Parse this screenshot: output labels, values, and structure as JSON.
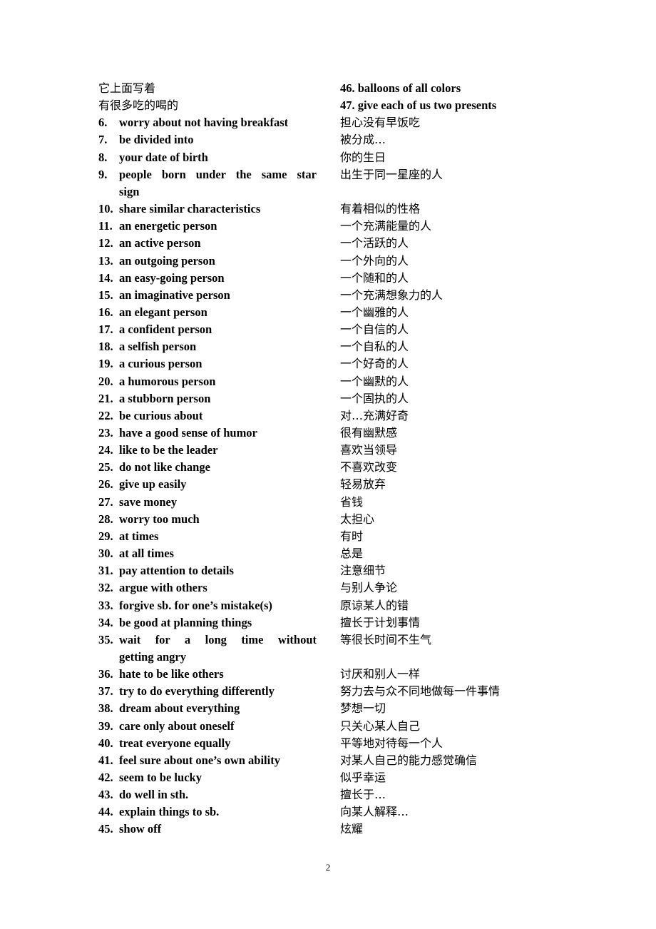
{
  "top_rows": [
    {
      "left_cn": "它上面写着",
      "right_en": "46. balloons of all colors"
    },
    {
      "left_cn": "有很多吃的喝的",
      "right_en": "47. give each of us two presents"
    }
  ],
  "entries": [
    {
      "num": "6.",
      "en": "worry about not having breakfast",
      "cn": "担心没有早饭吃"
    },
    {
      "num": "7.",
      "en": "be divided into",
      "cn": "被分成…"
    },
    {
      "num": "8.",
      "en": "your date of birth",
      "cn": "你的生日"
    },
    {
      "num": "9.",
      "en": "people born under the same star",
      "en_cont": "sign",
      "cn": "出生于同一星座的人"
    },
    {
      "num": "10.",
      "en": "share similar characteristics",
      "cn": "有着相似的性格"
    },
    {
      "num": "11.",
      "en": "an energetic person",
      "cn": "一个充满能量的人"
    },
    {
      "num": "12.",
      "en": "an active person",
      "cn": "一个活跃的人"
    },
    {
      "num": "13.",
      "en": "an outgoing person",
      "cn": "一个外向的人"
    },
    {
      "num": "14.",
      "en": "an easy-going person",
      "cn": "一个随和的人"
    },
    {
      "num": "15.",
      "en": "an imaginative person",
      "cn": "一个充满想象力的人"
    },
    {
      "num": "16.",
      "en": "an elegant person",
      "cn": "一个幽雅的人"
    },
    {
      "num": "17.",
      "en": "a confident person",
      "cn": "一个自信的人"
    },
    {
      "num": "18.",
      "en": "a selfish person",
      "cn": "一个自私的人"
    },
    {
      "num": "19.",
      "en": "a curious person",
      "cn": "一个好奇的人"
    },
    {
      "num": "20.",
      "en": "a humorous person",
      "cn": "一个幽默的人"
    },
    {
      "num": "21.",
      "en": "a stubborn person",
      "cn": "一个固执的人"
    },
    {
      "num": "22.",
      "en": "be curious about",
      "cn": "对…充满好奇"
    },
    {
      "num": "23.",
      "en": "have a good sense of humor",
      "cn": "很有幽默感"
    },
    {
      "num": "24.",
      "en": "like to be the leader",
      "cn": "喜欢当领导"
    },
    {
      "num": "25.",
      "en": "do not like change",
      "cn": "不喜欢改变"
    },
    {
      "num": "26.",
      "en": "give up easily",
      "cn": "轻易放弃"
    },
    {
      "num": "27.",
      "en": "save money",
      "cn": "省钱"
    },
    {
      "num": "28.",
      "en": "worry too much",
      "cn": "太担心"
    },
    {
      "num": "29.",
      "en": "at times",
      "cn": "有时"
    },
    {
      "num": "30.",
      "en": "at all times",
      "cn": "总是"
    },
    {
      "num": "31.",
      "en": "pay attention to details",
      "cn": "注意细节"
    },
    {
      "num": "32.",
      "en": "argue with others",
      "cn": "与别人争论"
    },
    {
      "num": "33.",
      "en": "forgive sb. for one’s mistake(s)",
      "cn": "原谅某人的错"
    },
    {
      "num": "34.",
      "en": "be good at planning things",
      "cn": "擅长于计划事情"
    },
    {
      "num": "35.",
      "en": "wait for a long time without",
      "en_cont": "getting angry",
      "cn": "等很长时间不生气"
    },
    {
      "num": "36.",
      "en": "hate to be like others",
      "cn": "讨厌和别人一样"
    },
    {
      "num": "37.",
      "en": "try to do everything differently",
      "cn": "努力去与众不同地做每一件事情"
    },
    {
      "num": "38.",
      "en": "dream about everything",
      "cn": "梦想一切"
    },
    {
      "num": "39.",
      "en": "care only about oneself",
      "cn": "只关心某人自己"
    },
    {
      "num": "40.",
      "en": "treat everyone equally",
      "cn": "平等地对待每一个人"
    },
    {
      "num": "41.",
      "en": "feel sure about one’s own ability",
      "cn": "对某人自己的能力感觉确信"
    },
    {
      "num": "42.",
      "en": "seem to be lucky",
      "cn": "似乎幸运"
    },
    {
      "num": "43.",
      "en": "do well in sth.",
      "cn": "擅长于…"
    },
    {
      "num": "44.",
      "en": "explain things to sb.",
      "cn": "向某人解释…"
    },
    {
      "num": "45.",
      "en": "show off",
      "cn": "炫耀"
    }
  ],
  "page_number": "2"
}
